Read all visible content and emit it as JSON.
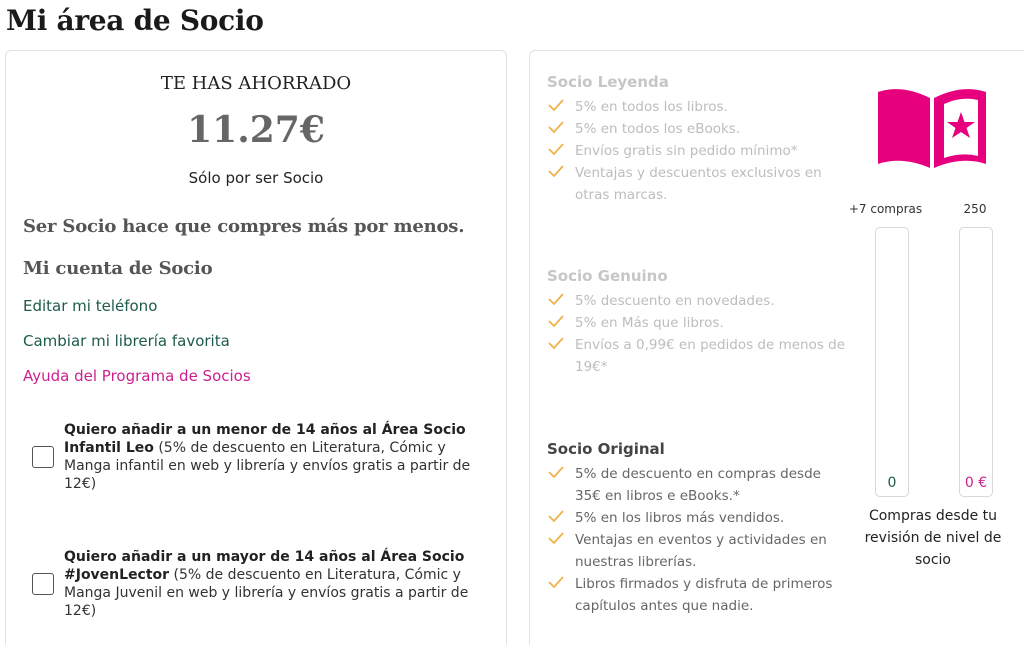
{
  "page": {
    "title": "Mi área de Socio"
  },
  "savings": {
    "label": "TE HAS AHORRADO",
    "amount": "11.27€",
    "subtitle": "Sólo por ser Socio"
  },
  "account": {
    "tagline": "Ser Socio hace que compres más por menos.",
    "heading": "Mi cuenta de Socio",
    "links": [
      {
        "label": "Editar mi teléfono"
      },
      {
        "label": "Cambiar mi librería favorita"
      },
      {
        "label": "Ayuda del Programa de Socios"
      }
    ]
  },
  "optins": [
    {
      "bold": "Quiero añadir a un menor de 14 años al Área Socio Infantil Leo",
      "text": " (5% de descuento en Literatura, Cómic y Manga infantil en web y librería y envíos gratis a partir de 12€)",
      "checked": false
    },
    {
      "bold": "Quiero añadir a un mayor de 14 años al Área Socio #JovenLector",
      "text": " (5% de descuento en Literatura, Cómic y Manga Juvenil en web y librería y envíos gratis a partir de 12€)",
      "checked": false
    }
  ],
  "tiers": [
    {
      "name": "Socio Leyenda",
      "active": false,
      "benefits": [
        "5% en todos los libros.",
        "5% en todos los eBooks.",
        "Envíos gratis sin pedido mínimo*",
        "Ventajas y descuentos exclusivos en otras marcas."
      ]
    },
    {
      "name": "Socio Genuino",
      "active": false,
      "benefits": [
        "5% descuento en novedades.",
        "5% en Más que libros.",
        "Envíos a 0,99€ en pedidos de menos de 19€*"
      ]
    },
    {
      "name": "Socio Original",
      "active": true,
      "benefits": [
        "5% de descuento en compras desde 35€ en libros e eBooks.*",
        "5% en los libros más vendidos.",
        "Ventajas en eventos y actividades en nuestras librerías.",
        "Libros firmados y disfruta de primeros capítulos antes que nadie."
      ]
    }
  ],
  "progress": {
    "purchases_target_label": "+7 compras",
    "amount_target_label": "250",
    "purchases_value": "0",
    "amount_value": "0 €",
    "caption": "Compras desde tu revisión de nivel de socio"
  },
  "icons": {
    "check": "check-icon",
    "book": "book-star-icon"
  },
  "colors": {
    "brand_pink": "#e6007e",
    "link_green": "#1d5a4a",
    "link_pink": "#cc1f8f",
    "check_orange": "#f0b24a"
  }
}
